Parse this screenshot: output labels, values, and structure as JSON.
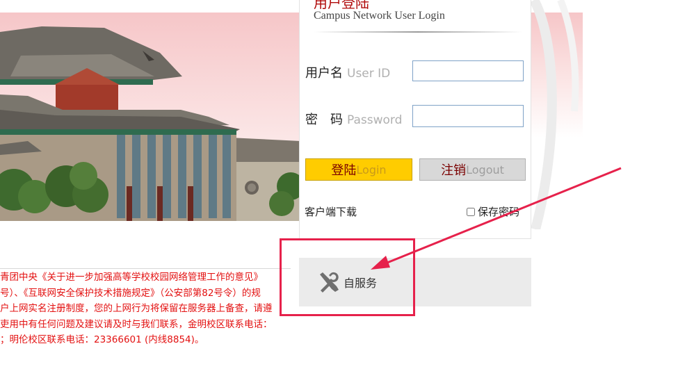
{
  "login": {
    "title_cn": "用户登陆",
    "title_en": "Campus Network User Login",
    "username_label": "用户名",
    "username_label_en": "User ID",
    "username_value": "",
    "password_label": "密　码",
    "password_label_en": "Password",
    "password_value": "",
    "login_button": "登陆",
    "login_button_en": "Login",
    "logout_button": "注销",
    "logout_button_en": "Logout",
    "client_download": "客户端下载",
    "remember_password": "保存密码",
    "remember_checked": false
  },
  "service": {
    "label": "自服务",
    "icon": "tools-icon"
  },
  "notice": {
    "lines": [
      "青团中央《关于进一步加强高等学校校园网络管理工作的意见》",
      "号）、《互联网安全保护技术措施规定》（公安部第82号令）的规",
      "户上网实名注册制度，您的上网行为将保留在服务器上备查，请遵",
      "吏用中有任何问题及建议请及时与我们联系，金明校区联系电话：",
      "；明伦校区联系电话：23366601 (内线8854)。"
    ]
  },
  "colors": {
    "accent_red": "#e31010",
    "login_yellow": "#ffcc00",
    "annotation": "#e6214b"
  }
}
